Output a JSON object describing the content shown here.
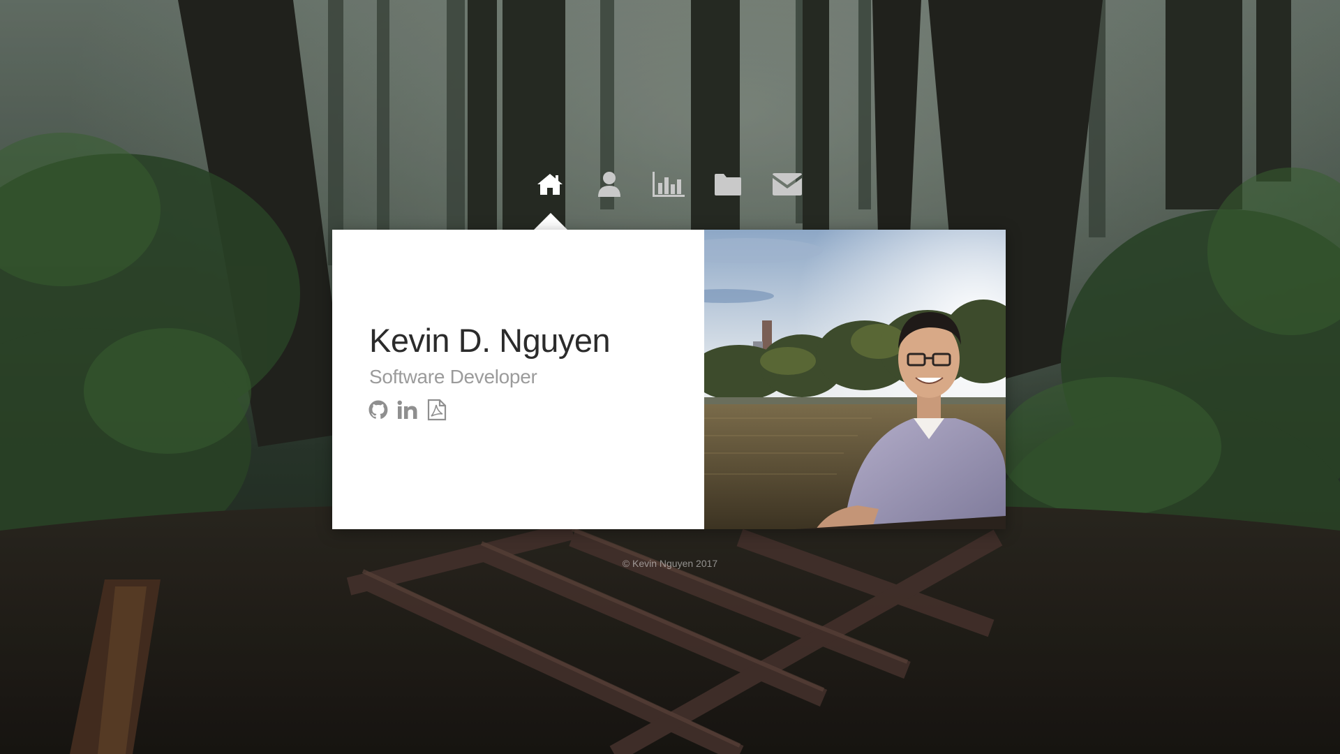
{
  "nav": {
    "items": [
      {
        "icon": "home-icon",
        "active": true
      },
      {
        "icon": "user-icon",
        "active": false
      },
      {
        "icon": "bar-chart-icon",
        "active": false
      },
      {
        "icon": "folder-icon",
        "active": false
      },
      {
        "icon": "envelope-icon",
        "active": false
      }
    ],
    "active_color": "#ffffff",
    "inactive_color": "#c9c9c9"
  },
  "profile": {
    "name": "Kevin D. Nguyen",
    "title": "Software Developer",
    "socials": [
      {
        "icon": "github-icon"
      },
      {
        "icon": "linkedin-icon"
      },
      {
        "icon": "pdf-file-icon"
      }
    ],
    "photo": "portrait-photo"
  },
  "footer": {
    "copyright": "© Kevin Nguyen 2017"
  },
  "colors": {
    "card_bg": "#ffffff",
    "name_text": "#2b2b2b",
    "title_text": "#9b9b9b",
    "social_icon": "#8f8f8f"
  }
}
